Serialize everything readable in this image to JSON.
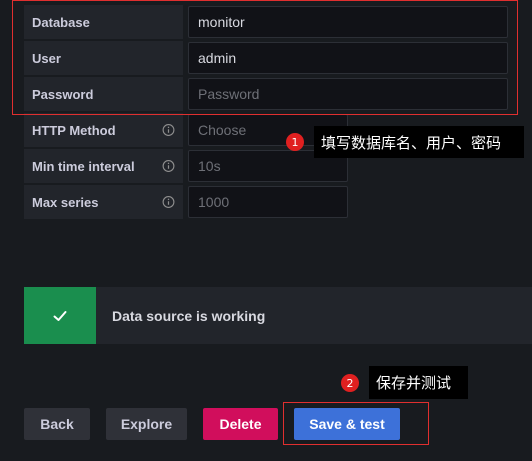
{
  "form": {
    "database": {
      "label": "Database",
      "value": "monitor"
    },
    "user": {
      "label": "User",
      "value": "admin"
    },
    "password": {
      "label": "Password",
      "placeholder": "Password"
    },
    "http_method": {
      "label": "HTTP Method",
      "placeholder": "Choose"
    },
    "min_time_interval": {
      "label": "Min time interval",
      "placeholder": "10s"
    },
    "max_series": {
      "label": "Max series",
      "placeholder": "1000"
    }
  },
  "annotations": {
    "step1": {
      "number": "1",
      "text": "填写数据库名、用户、密码"
    },
    "step2": {
      "number": "2",
      "text": "保存并测试"
    },
    "color": "#e02f2f"
  },
  "status": {
    "text": "Data source is working",
    "icon": "check-icon",
    "color": "#1a8e4e"
  },
  "buttons": {
    "back": "Back",
    "explore": "Explore",
    "delete": "Delete",
    "save_test": "Save & test"
  }
}
